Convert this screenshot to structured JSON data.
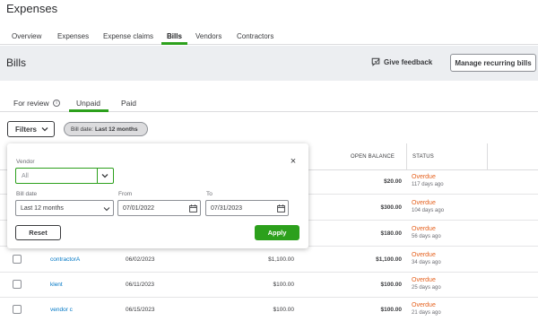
{
  "app": {
    "title": "Expenses"
  },
  "top_tabs": [
    "Overview",
    "Expenses",
    "Expense claims",
    "Bills",
    "Vendors",
    "Contractors"
  ],
  "page": {
    "title": "Bills",
    "feedback_label": "Give feedback",
    "manage_label": "Manage recurring bills"
  },
  "sub_tabs": [
    "For review",
    "Unpaid",
    "Paid"
  ],
  "filters": {
    "button_label": "Filters",
    "chip_prefix": "Bill date:",
    "chip_value": "Last 12 months"
  },
  "table": {
    "headers": {
      "open_balance": "OPEN BALANCE",
      "status": "STATUS"
    },
    "rows": [
      {
        "payee": "",
        "date": "",
        "amount": "",
        "open_balance": "$20.00",
        "status": "Overdue",
        "due": "117 days ago"
      },
      {
        "payee": "",
        "date": "",
        "amount": "",
        "open_balance": "$300.00",
        "status": "Overdue",
        "due": "104 days ago"
      },
      {
        "payee": "",
        "date": "",
        "amount": "",
        "open_balance": "$180.00",
        "status": "Overdue",
        "due": "56 days ago"
      },
      {
        "payee": "contractorA",
        "date": "06/02/2023",
        "amount": "$1,100.00",
        "open_balance": "$1,100.00",
        "status": "Overdue",
        "due": "34 days ago"
      },
      {
        "payee": "klent",
        "date": "06/11/2023",
        "amount": "$100.00",
        "open_balance": "$100.00",
        "status": "Overdue",
        "due": "25 days ago"
      },
      {
        "payee": "vendor c",
        "date": "06/15/2023",
        "amount": "$100.00",
        "open_balance": "$100.00",
        "status": "Overdue",
        "due": "21 days ago"
      }
    ]
  },
  "filter_panel": {
    "vendor_label": "Vendor",
    "vendor_placeholder": "All",
    "bill_date_label": "Bill date",
    "bill_date_value": "Last 12 months",
    "from_label": "From",
    "from_value": "07/01/2022",
    "to_label": "To",
    "to_value": "07/31/2023",
    "reset_label": "Reset",
    "apply_label": "Apply"
  },
  "colors": {
    "accent": "#2ca01c",
    "link": "#0077c5",
    "overdue": "#e5621f"
  },
  "icons": [
    "comment-icon",
    "info-icon",
    "chevron-down-icon",
    "close-icon",
    "calendar-icon"
  ]
}
